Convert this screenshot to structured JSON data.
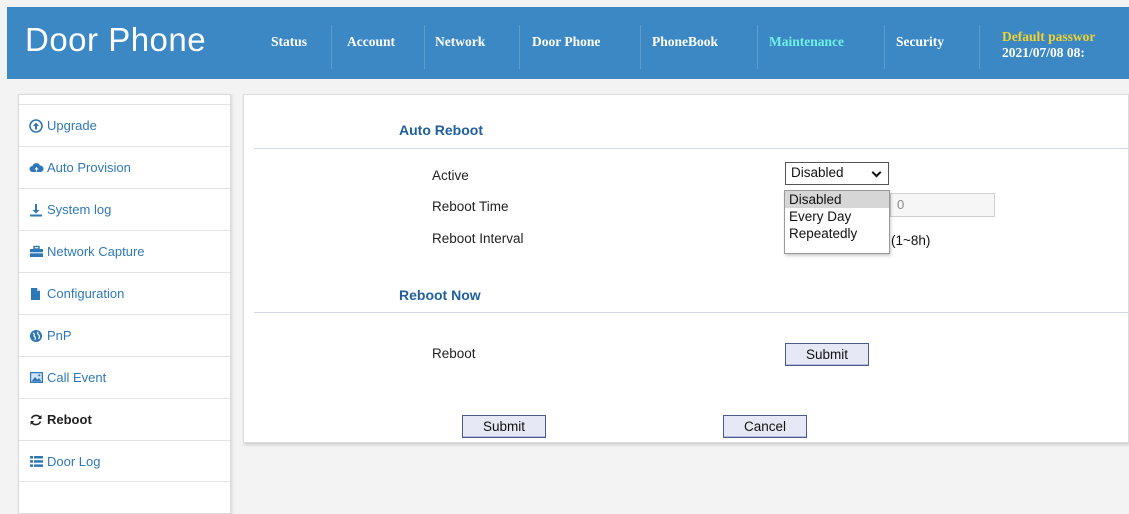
{
  "header": {
    "title": "Door Phone",
    "nav": [
      {
        "label": "Status",
        "active": false
      },
      {
        "label": "Account",
        "active": false
      },
      {
        "label": "Network",
        "active": false
      },
      {
        "label": "Door Phone",
        "active": false
      },
      {
        "label": "PhoneBook",
        "active": false
      },
      {
        "label": "Maintenance",
        "active": true
      },
      {
        "label": "Security",
        "active": false
      }
    ],
    "warning": "Default passwor",
    "datetime": "2021/07/08 08:"
  },
  "sidebar": {
    "items": [
      {
        "label": "Upgrade",
        "icon": "upgrade-icon"
      },
      {
        "label": "Auto Provision",
        "icon": "cloud-icon"
      },
      {
        "label": "System log",
        "icon": "download-icon"
      },
      {
        "label": "Network Capture",
        "icon": "briefcase-icon"
      },
      {
        "label": "Configuration",
        "icon": "file-icon"
      },
      {
        "label": "PnP",
        "icon": "globe-icon"
      },
      {
        "label": "Call Event",
        "icon": "picture-icon"
      },
      {
        "label": "Reboot",
        "icon": "refresh-icon",
        "active": true
      },
      {
        "label": "Door Log",
        "icon": "list-icon"
      }
    ]
  },
  "auto_reboot": {
    "title": "Auto Reboot",
    "active_label": "Active",
    "active_value": "Disabled",
    "options": [
      "Disabled",
      "Every Day",
      "Repeatedly"
    ],
    "reboot_time_label": "Reboot Time",
    "reboot_time_value": "0",
    "reboot_interval_label": "Reboot Interval",
    "reboot_interval_hint": "(1~8h)"
  },
  "reboot_now": {
    "title": "Reboot Now",
    "reboot_label": "Reboot",
    "submit_label": "Submit"
  },
  "footer": {
    "submit_label": "Submit",
    "cancel_label": "Cancel"
  },
  "colors": {
    "header_bg": "#3b88c4",
    "nav_active": "#6ff0e6",
    "warning": "#f2d22b",
    "link": "#2f78b8"
  }
}
